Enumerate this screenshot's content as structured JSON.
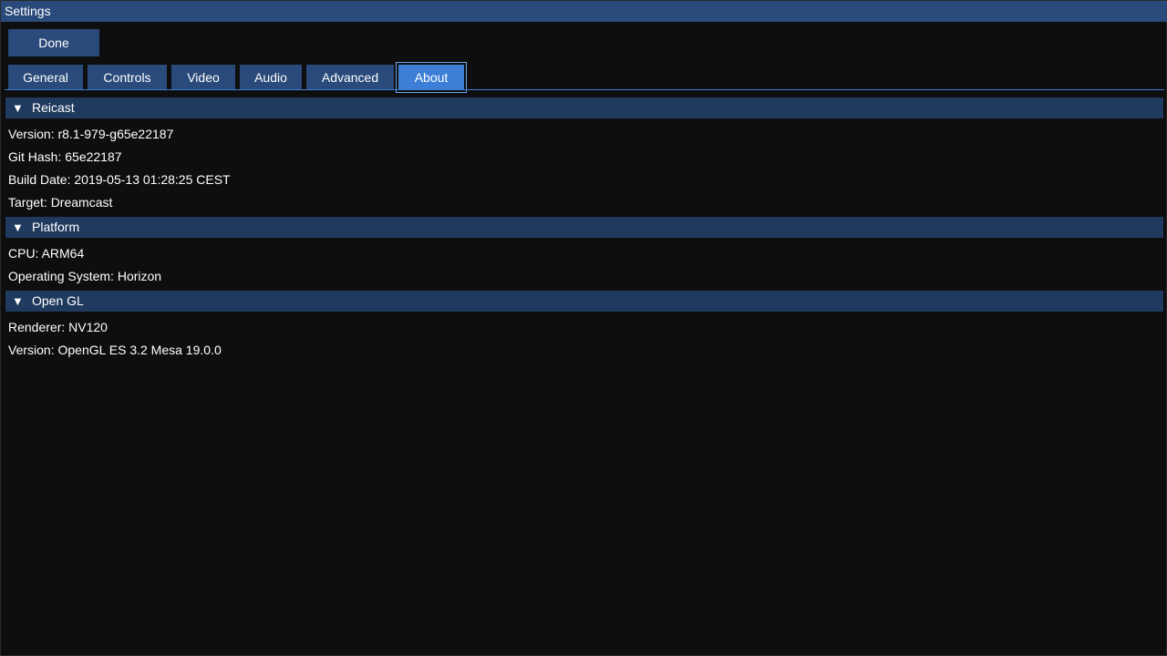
{
  "window": {
    "title": "Settings"
  },
  "toolbar": {
    "done_label": "Done"
  },
  "tabs": [
    {
      "label": "General"
    },
    {
      "label": "Controls"
    },
    {
      "label": "Video"
    },
    {
      "label": "Audio"
    },
    {
      "label": "Advanced"
    },
    {
      "label": "About",
      "active": true
    }
  ],
  "sections": {
    "reicast": {
      "title": "Reicast",
      "version": "Version: r8.1-979-g65e22187",
      "git_hash": "Git Hash: 65e22187",
      "build_date": "Build Date: 2019-05-13 01:28:25 CEST",
      "target": "Target: Dreamcast"
    },
    "platform": {
      "title": "Platform",
      "cpu": "CPU: ARM64",
      "os": "Operating System: Horizon"
    },
    "opengl": {
      "title": "Open GL",
      "renderer": "Renderer: NV120",
      "version": "Version: OpenGL ES 3.2 Mesa 19.0.0"
    }
  },
  "icons": {
    "collapse": "triangle-down-icon",
    "glyph": "▼"
  },
  "colors": {
    "titlebar": "#294a7a",
    "button": "#294a7a",
    "active_tab": "#3d7fd6",
    "section_header": "#1f3a5e",
    "background": "#0e0e0e"
  }
}
